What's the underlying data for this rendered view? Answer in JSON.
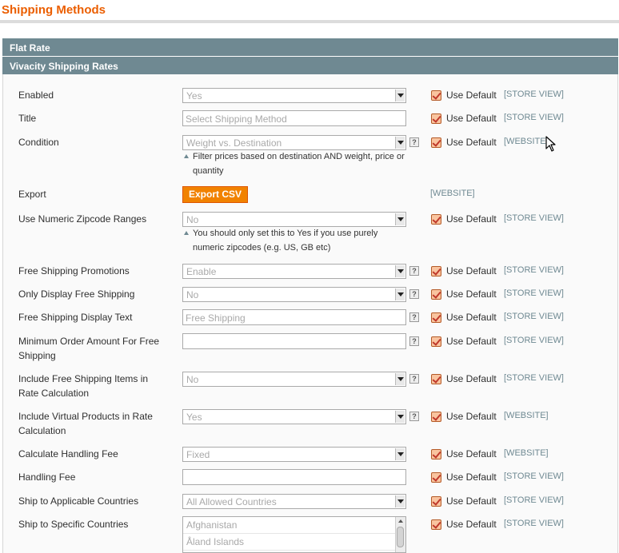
{
  "page": {
    "title": "Shipping Methods"
  },
  "sections": {
    "flat_rate": "Flat Rate",
    "vivacity": "Vivacity Shipping Rates"
  },
  "common": {
    "use_default": "Use Default"
  },
  "fields": {
    "enabled": {
      "label": "Enabled",
      "value": "Yes",
      "scope": "[STORE VIEW]"
    },
    "title": {
      "label": "Title",
      "placeholder": "Select Shipping Method",
      "scope": "[STORE VIEW]"
    },
    "condition": {
      "label": "Condition",
      "value": "Weight vs. Destination",
      "note_line1": "Filter prices based on destination AND weight, price or",
      "note_line2": "quantity",
      "scope": "[WEBSITE]"
    },
    "export": {
      "label": "Export",
      "button": "Export CSV",
      "scope": "[WEBSITE]"
    },
    "numeric_zip": {
      "label": "Use Numeric Zipcode Ranges",
      "value": "No",
      "note_line1": "You should only set this to Yes if you use purely",
      "note_line2": "numeric zipcodes (e.g. US, GB etc)",
      "scope": "[STORE VIEW]"
    },
    "free_promos": {
      "label": "Free Shipping Promotions",
      "value": "Enable",
      "scope": "[STORE VIEW]"
    },
    "only_free": {
      "label": "Only Display Free Shipping",
      "value": "No",
      "scope": "[STORE VIEW]"
    },
    "free_text": {
      "label": "Free Shipping Display Text",
      "placeholder": "Free Shipping",
      "scope": "[STORE VIEW]"
    },
    "min_order": {
      "label_line1": "Minimum Order Amount For Free",
      "label_line2": "Shipping",
      "value": "",
      "scope": "[STORE VIEW]"
    },
    "include_free": {
      "label_line1": "Include Free Shipping Items in",
      "label_line2": "Rate Calculation",
      "value": "No",
      "scope": "[STORE VIEW]"
    },
    "include_virtual": {
      "label_line1": "Include Virtual Products in Rate",
      "label_line2": "Calculation",
      "value": "Yes",
      "scope": "[WEBSITE]"
    },
    "handling_type": {
      "label": "Calculate Handling Fee",
      "value": "Fixed",
      "scope": "[WEBSITE]"
    },
    "handling_fee": {
      "label": "Handling Fee",
      "value": "",
      "scope": "[STORE VIEW]"
    },
    "applicable_countries": {
      "label": "Ship to Applicable Countries",
      "value": "All Allowed Countries",
      "scope": "[STORE VIEW]"
    },
    "specific_countries": {
      "label": "Ship to Specific Countries",
      "options": [
        "Afghanistan",
        "Åland Islands"
      ],
      "scope": "[STORE VIEW]"
    }
  },
  "help_glyph": "?",
  "icons": {
    "select_arrow": "chevron-down-icon",
    "help": "help-icon",
    "checkbox": "checkbox-checked-icon",
    "cursor": "mouse-cursor-icon"
  },
  "colors": {
    "title": "#eb5e00",
    "header": "#6f8992",
    "button": "#f18200",
    "scope": "#6f8992"
  }
}
